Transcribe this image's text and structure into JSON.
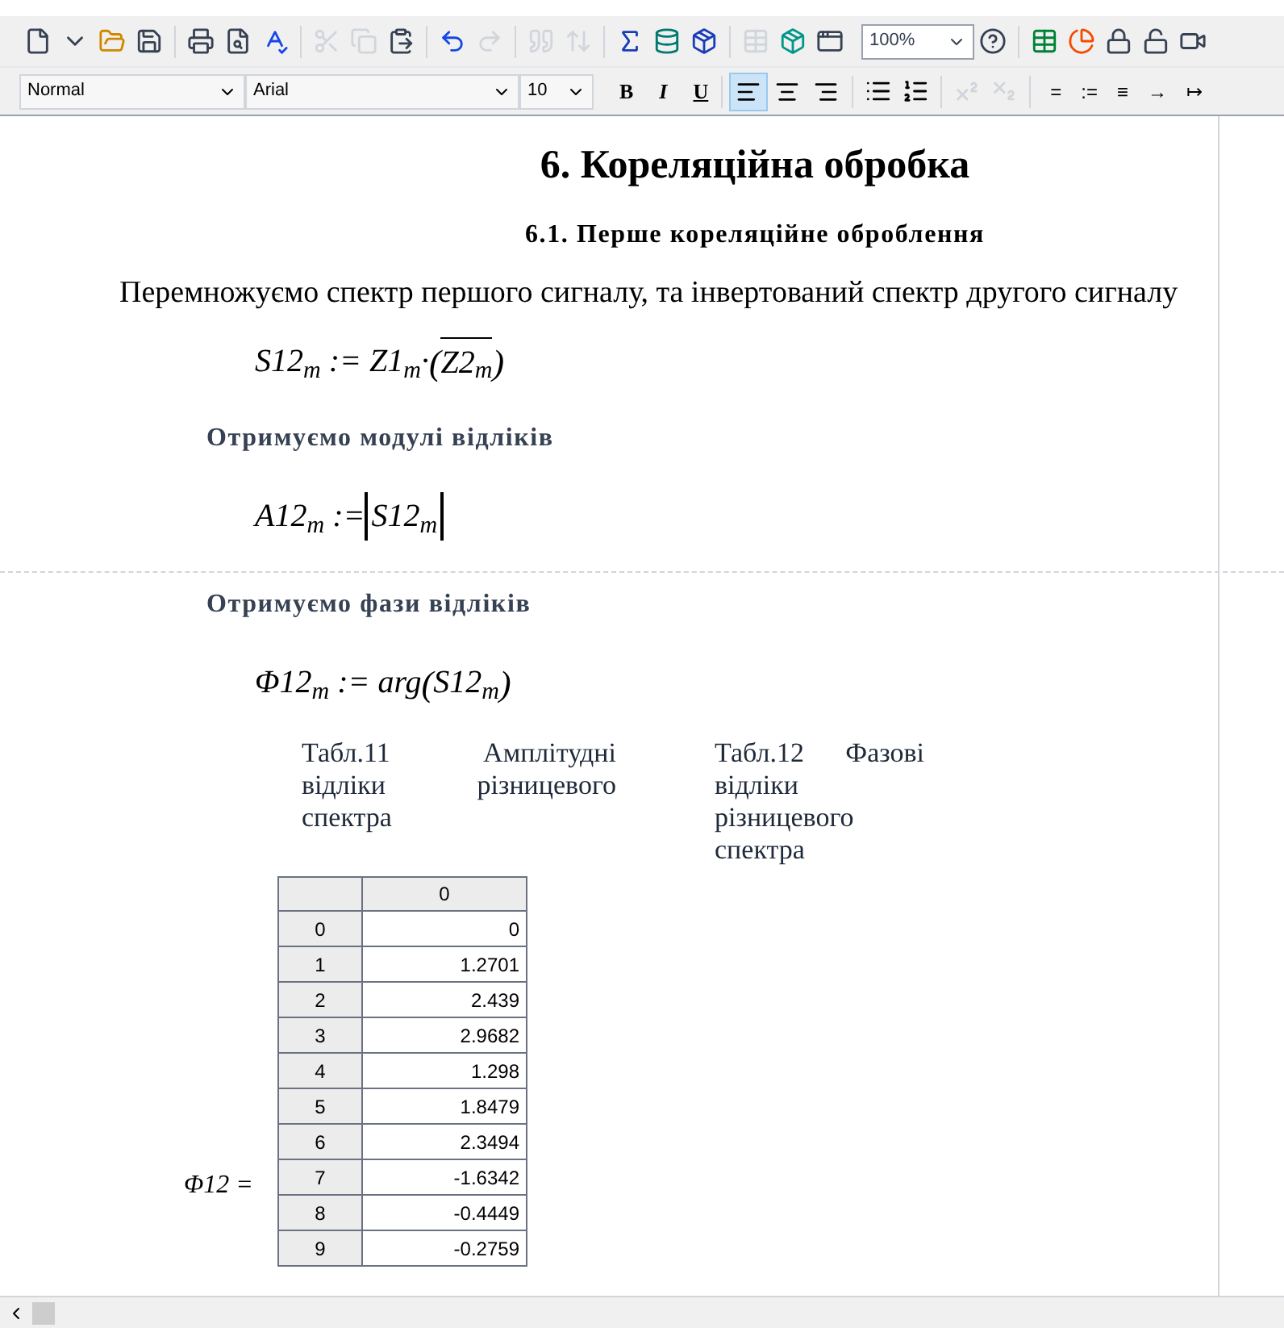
{
  "toolbar": {
    "zoom": "100%"
  },
  "format_bar": {
    "style": "Normal",
    "font": "Arial",
    "size": "10",
    "text_buttons": [
      {
        "label": "B",
        "kind": "bold"
      },
      {
        "label": "I",
        "kind": "italic"
      },
      {
        "label": "U",
        "kind": "underline"
      }
    ],
    "align_buttons": [
      {
        "kind": "left",
        "selected": true
      },
      {
        "kind": "center",
        "selected": false
      },
      {
        "kind": "right",
        "selected": false
      }
    ],
    "operator_buttons": [
      "=",
      ":=",
      "≡",
      "→",
      "↦"
    ]
  },
  "document": {
    "title": "6. Кореляційна обробка",
    "subtitle": "6.1. Перше кореляційне оброблення",
    "intro": "Перемножуємо спектр першого сигналу, та інвертований спектр другого сигналу",
    "blocks": [
      {
        "kind": "formula",
        "parts": [
          {
            "kind": "text",
            "text": "S12$_{m}$ := Z1$_{m}$·"
          },
          {
            "kind": "group",
            "open": "(",
            "close": ")",
            "children": [
              {
                "kind": "overline",
                "text": "Z2$_{m}$"
              }
            ]
          }
        ]
      },
      {
        "kind": "note",
        "text": "Отримуємо модулі відліків"
      },
      {
        "kind": "formula",
        "parts": [
          {
            "kind": "text",
            "text": "A12$_{m}$ := "
          },
          {
            "kind": "abs",
            "text": "S12$_{m}$"
          }
        ]
      },
      {
        "kind": "pagebreak"
      },
      {
        "kind": "note",
        "text": "Отримуємо фази відліків"
      },
      {
        "kind": "formula",
        "parts": [
          {
            "kind": "text",
            "text": "Φ12$_{m}$ := arg"
          },
          {
            "kind": "group",
            "open": "(",
            "close": ")",
            "children": [
              {
                "kind": "text",
                "text": "S12$_{m}$"
              }
            ]
          }
        ]
      }
    ],
    "captions": [
      "Табл.11 Амплітудні відліки різницевого спектра",
      "Табл.12 Фазові відліки різницевого спектра"
    ],
    "matrix": {
      "label": "Φ12 =",
      "column": "0",
      "rows": [
        [
          "0",
          "0"
        ],
        [
          "1",
          "1.2701"
        ],
        [
          "2",
          "2.439"
        ],
        [
          "3",
          "2.9682"
        ],
        [
          "4",
          "1.298"
        ],
        [
          "5",
          "1.8479"
        ],
        [
          "6",
          "2.3494"
        ],
        [
          "7",
          "-1.6342"
        ],
        [
          "8",
          "-0.4449"
        ],
        [
          "9",
          "-0.2759"
        ]
      ]
    }
  }
}
